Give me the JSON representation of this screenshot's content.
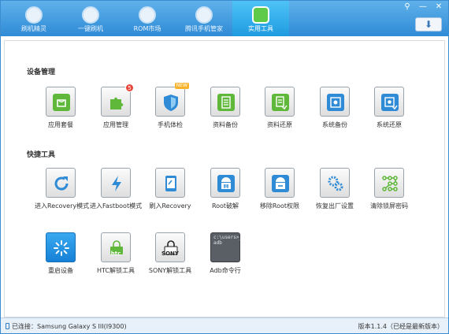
{
  "tabs": [
    {
      "label": "刷机精灵",
      "icon": "s-logo-icon"
    },
    {
      "label": "一键刷机",
      "icon": "cursor-icon"
    },
    {
      "label": "ROM市场",
      "icon": "android-icon"
    },
    {
      "label": "腾讯手机管家",
      "icon": "shield-m-icon"
    },
    {
      "label": "实用工具",
      "icon": "grid-icon"
    }
  ],
  "active_tab": "实用工具",
  "window_controls": {
    "menu": "⚲",
    "minimize": "—",
    "close": "✕"
  },
  "update_button": "⬇",
  "sections": {
    "device": {
      "title": "设备管理",
      "items": [
        {
          "label": "应用套餐",
          "icon": "bag-icon",
          "color": "#5fb83a"
        },
        {
          "label": "应用管理",
          "icon": "puzzle-icon",
          "color": "#5fb83a",
          "badge": "5"
        },
        {
          "label": "手机体检",
          "icon": "shield-check-icon",
          "color": "#2f8bd6",
          "tag": "NEW"
        },
        {
          "label": "资料备份",
          "icon": "doc-icon",
          "color": "#5fb83a"
        },
        {
          "label": "资料还原",
          "icon": "doc-restore-icon",
          "color": "#5fb83a"
        },
        {
          "label": "系统备份",
          "icon": "system-backup-icon",
          "color": "#2f8bd6"
        },
        {
          "label": "系统还原",
          "icon": "system-restore-icon",
          "color": "#2f8bd6"
        }
      ]
    },
    "quick": {
      "title": "快捷工具",
      "items": [
        {
          "label": "进入Recovery模式",
          "icon": "refresh-icon",
          "color": "#2f8bd6"
        },
        {
          "label": "进入Fastboot模式",
          "icon": "lightning-icon",
          "color": "#2f8bd6"
        },
        {
          "label": "刷入Recovery",
          "icon": "tablet-icon",
          "color": "#2f8bd6"
        },
        {
          "label": "Root破解",
          "icon": "android-root-icon",
          "color": "#2f8bd6"
        },
        {
          "label": "移除Root权限",
          "icon": "android-remove-icon",
          "color": "#2f8bd6"
        },
        {
          "label": "恢复出厂设置",
          "icon": "gears-icon",
          "color": "#2f8bd6"
        },
        {
          "label": "清除锁屏密码",
          "icon": "pattern-lock-icon",
          "color": "#5fb83a"
        },
        {
          "label": "重启设备",
          "icon": "loading-icon",
          "color": "#2f8bd6"
        },
        {
          "label": "HTC解锁工具",
          "icon": "htc-lock-icon",
          "color": "#5fb83a",
          "text": "htc"
        },
        {
          "label": "SONY解锁工具",
          "icon": "sony-lock-icon",
          "color": "#2f8bd6",
          "text": "SONY"
        },
        {
          "label": "Adb命令行",
          "icon": "terminal-icon",
          "terminal": "c:\\users>_\nadb"
        }
      ]
    }
  },
  "status": {
    "connection": "已连接：Samsung Galaxy S III(I9300)",
    "version": "版本1.1.4（已经是最新版本）"
  }
}
